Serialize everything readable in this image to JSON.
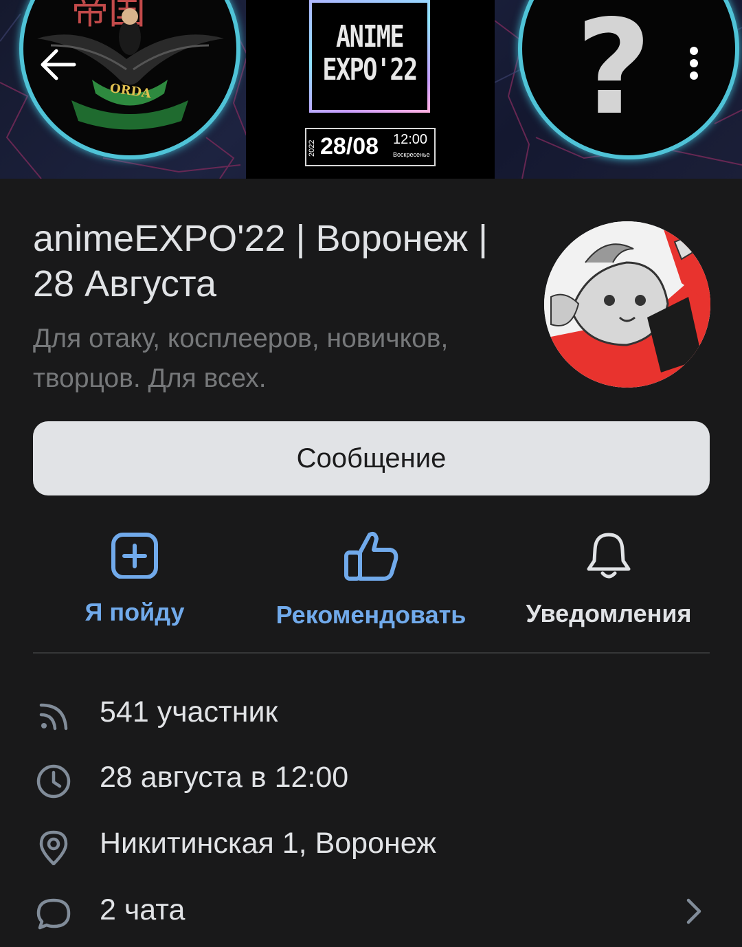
{
  "cover": {
    "left_logo_text": "ORDA",
    "poster_title_line1": "ANIME",
    "poster_title_line2": "EXPO'22",
    "poster_year": "2022",
    "poster_date": "28/08",
    "poster_time": "12:00",
    "poster_weekday": "Воскресенье",
    "right_symbol": "?"
  },
  "header": {
    "title": "animeEXPO'22 | Воронеж | 28 Августа",
    "description": "Для отаку, косплееров, новичков, творцов. Для всех."
  },
  "message_button": {
    "label": "Сообщение"
  },
  "actions": [
    {
      "label": "Я пойду",
      "icon": "add-square-icon",
      "color": "#71aaeb"
    },
    {
      "label": "Рекомендовать",
      "icon": "thumbs-up-icon",
      "color": "#71aaeb"
    },
    {
      "label": "Уведомления",
      "icon": "bell-icon",
      "color": "#e1e3e6"
    }
  ],
  "info": {
    "members": "541 участник",
    "datetime": "28 августа в 12:00",
    "address": "Никитинская 1, Воронеж",
    "chats": "2 чата"
  },
  "colors": {
    "background": "#19191a",
    "accent": "#71aaeb",
    "text": "#e1e3e6",
    "secondary_text": "#76787a",
    "button_bg": "#e1e3e6"
  }
}
